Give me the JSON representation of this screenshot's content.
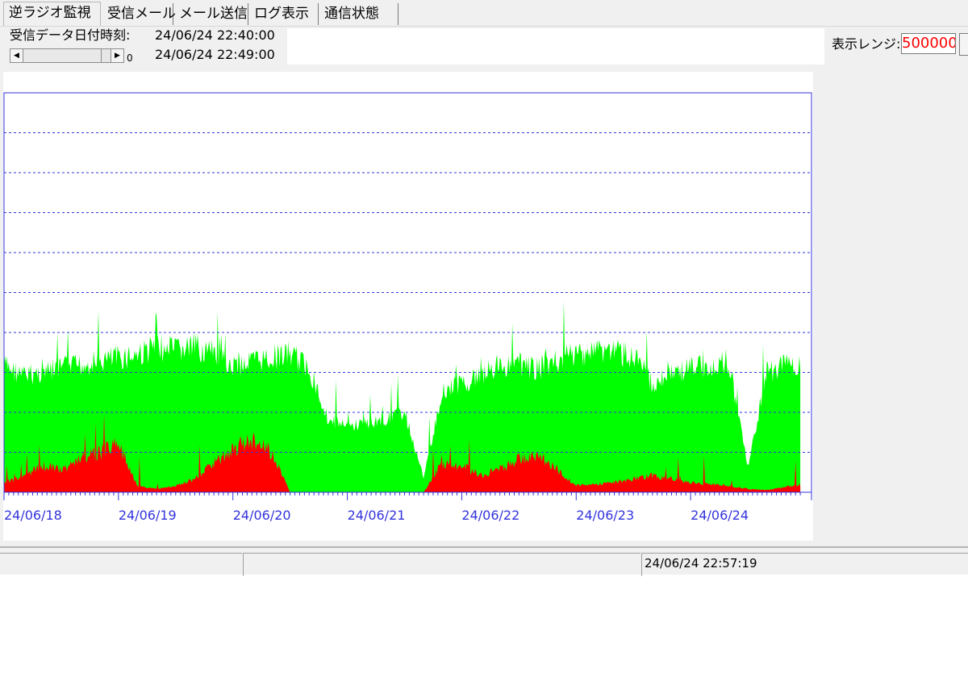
{
  "tabs": [
    {
      "label": "逆ラジオ監視",
      "active": true
    },
    {
      "label": "受信メール",
      "active": false
    },
    {
      "label": "メール送信",
      "active": false
    },
    {
      "label": "ログ表示",
      "active": false
    },
    {
      "label": "通信状態",
      "active": false
    }
  ],
  "header": {
    "received_label": "受信データ日付時刻:",
    "time_start": "24/06/24 22:40:00",
    "time_end": "24/06/24 22:49:00",
    "scroll_value": "0",
    "range_label": "表示レンジ:",
    "range_value": "500000"
  },
  "status": {
    "time": "24/06/24 22:57:19"
  },
  "colors": {
    "accent": "#3333dd",
    "series_green": "#00ff00",
    "series_red": "#ff0000",
    "range_text": "#ff0000"
  },
  "chart_data": {
    "type": "area",
    "title": "",
    "xlabel": "",
    "ylabel": "",
    "x_tick_labels": [
      "24/06/18",
      "24/06/19",
      "24/06/20",
      "24/06/21",
      "24/06/22",
      "24/06/23",
      "24/06/24"
    ],
    "x_range": [
      "24/06/18 00:00",
      "24/06/24 23:00"
    ],
    "ylim": [
      0,
      500000
    ],
    "grid": true,
    "y_gridlines": 10,
    "x_minor_ticks_per_day": 24,
    "series": [
      {
        "color": "#00ff00",
        "x_hours": [
          0,
          4,
          8,
          12,
          16,
          20,
          24,
          28,
          32,
          36,
          40,
          44,
          48,
          52,
          56,
          60,
          64,
          68,
          70,
          72,
          76,
          80,
          84,
          88,
          92,
          96,
          100,
          104,
          108,
          112,
          116,
          120,
          124,
          128,
          132,
          136,
          140,
          144,
          148,
          152,
          156,
          160,
          164,
          167
        ],
        "values": [
          175000,
          160000,
          165000,
          170000,
          175000,
          180000,
          185000,
          190000,
          200000,
          195000,
          200000,
          190000,
          175000,
          180000,
          185000,
          190000,
          170000,
          100000,
          95000,
          90000,
          95000,
          100000,
          110000,
          20000,
          140000,
          150000,
          160000,
          175000,
          175000,
          170000,
          180000,
          190000,
          195000,
          195000,
          185000,
          150000,
          165000,
          170000,
          175000,
          180000,
          35000,
          165000,
          175000,
          170000
        ]
      },
      {
        "color": "#ff0000",
        "x_hours": [
          0,
          4,
          8,
          12,
          16,
          20,
          24,
          28,
          32,
          36,
          40,
          44,
          48,
          52,
          56,
          60,
          64,
          68,
          70,
          72,
          76,
          80,
          84,
          88,
          92,
          96,
          100,
          104,
          108,
          112,
          116,
          120,
          124,
          128,
          132,
          136,
          140,
          144,
          148,
          152,
          156,
          160,
          164,
          167
        ],
        "values": [
          15000,
          22000,
          40000,
          35000,
          50000,
          60000,
          75000,
          10000,
          5000,
          10000,
          20000,
          45000,
          65000,
          80000,
          60000,
          0,
          0,
          0,
          0,
          0,
          0,
          0,
          0,
          0,
          45000,
          40000,
          25000,
          35000,
          50000,
          55000,
          35000,
          10000,
          12000,
          15000,
          20000,
          25000,
          20000,
          15000,
          12000,
          10000,
          5000,
          3000,
          8000,
          12000
        ]
      }
    ]
  }
}
